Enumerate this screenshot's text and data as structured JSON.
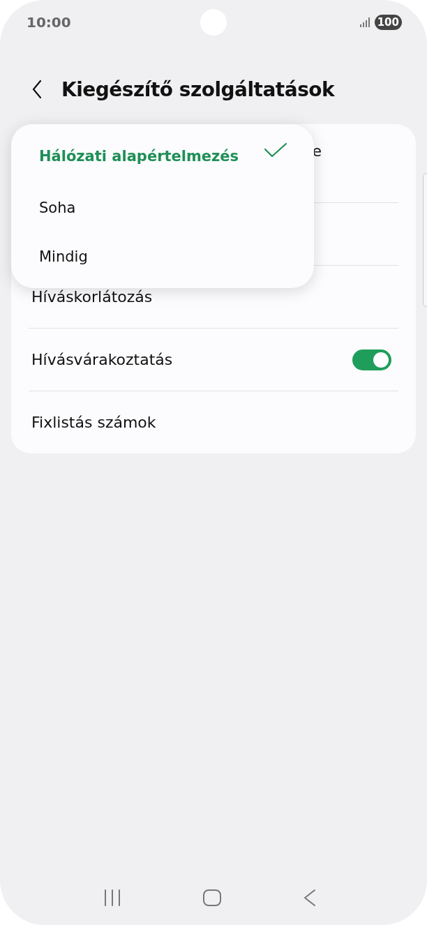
{
  "status_bar": {
    "time": "10:00",
    "battery": "100"
  },
  "header": {
    "title": "Kiegészítő szolgáltatások"
  },
  "settings": [
    {
      "kind": "covered",
      "label": "e"
    },
    {
      "kind": "hidden"
    },
    {
      "kind": "plain",
      "label": "Híváskorlátozás"
    },
    {
      "kind": "toggle",
      "label": "Hívásvárakoztatás",
      "on": true
    },
    {
      "kind": "plain",
      "label": "Fixlistás számok"
    }
  ],
  "menu": {
    "options": [
      {
        "label": "Hálózati alapértelmezés",
        "selected": true
      },
      {
        "label": "Soha",
        "selected": false
      },
      {
        "label": "Mindig",
        "selected": false
      }
    ]
  }
}
